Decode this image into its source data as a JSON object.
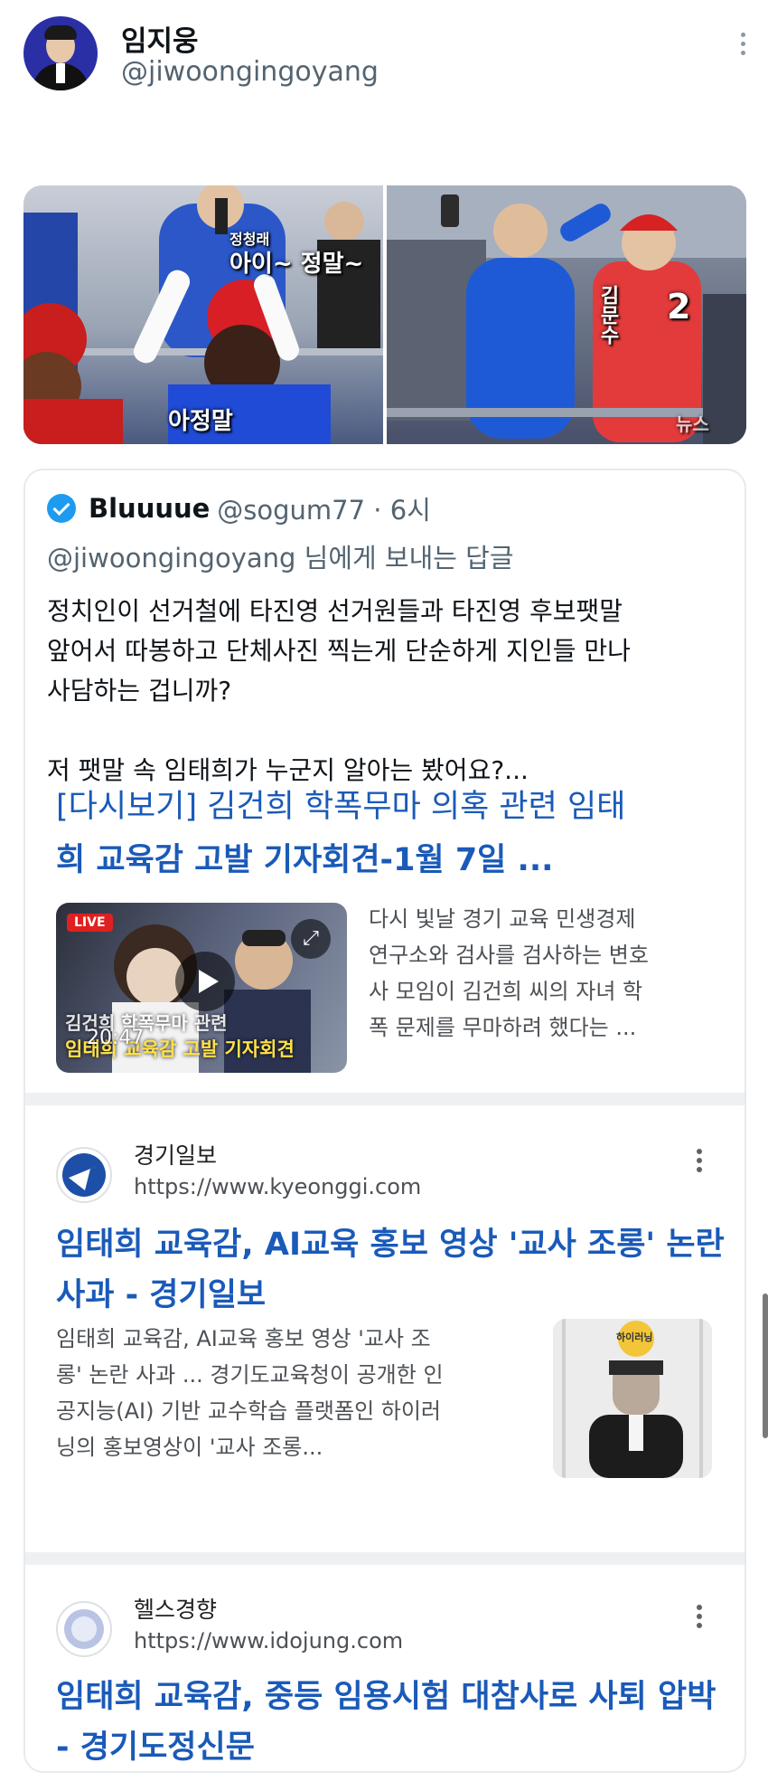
{
  "tweet": {
    "author_name": "임지웅",
    "author_handle": "@jiwoongingoyang"
  },
  "photos": {
    "left_captions": [
      "정청래",
      "아이~ 정말~",
      "아정말"
    ],
    "right_captions": [
      "김문수",
      "2",
      "뉴스"
    ]
  },
  "quote": {
    "name": "Bluuuue",
    "meta": "@sogum77 · 6시",
    "reply_mention": "@jiwoongingoyang",
    "reply_suffix": " 님에게 보내는 답글",
    "text": "정치인이 선거철에 타진영 선거원들과 타진영 후보팻말\n앞어서 따봉하고 단체사진 찍는게 단순하게 지인들 만나\n사담하는 겁니까?\n\n저 팻말 속 임태희가 누군지 알아는 봤어요?..."
  },
  "embed": {
    "result1": {
      "cut_title": "[다시보기] 김건희 학폭무마 의혹 관련 임태",
      "title_line2": "희 교육감 고발 기자회견-1월 7일 ...",
      "video_live": "LIVE",
      "video_caption": "김건희 학폭무마 관련",
      "video_caption2": "임태희 교육감 고발 기자회견",
      "video_duration": "20:47",
      "snippet": "다시 빛날 경기 교육 민생경제\n연구소와 검사를 검사하는 변호\n사 모임이 김건희 씨의 자녀 학\n폭 문제를 무마하려 했다는 ..."
    },
    "result2": {
      "site": "경기일보",
      "url": "https://www.kyeonggi.com",
      "title": "임태희 교육감, AI교육 홍보 영상 '교사 조롱' 논란 사과 - 경기일보",
      "snippet": "임태희 교육감, AI교육 홍보 영상 '교사 조\n롱' 논란 사과 ... 경기도교육청이 공개한 인\n공지능(AI) 기반 교수학습 플랫폼인 하이러\n닝의 홍보영상이 '교사 조롱...",
      "thumb_caption": "하이러닝"
    },
    "result3": {
      "site": "헬스경향",
      "url": "https://www.idojung.com",
      "title": "임태희 교육감, 중등 임용시험 대참사로 사퇴 압박 - 경기도정신문"
    }
  },
  "colors": {
    "link_blue": "#1a5ab8",
    "verified_blue": "#1d9bf0",
    "secondary_text": "#536471"
  }
}
